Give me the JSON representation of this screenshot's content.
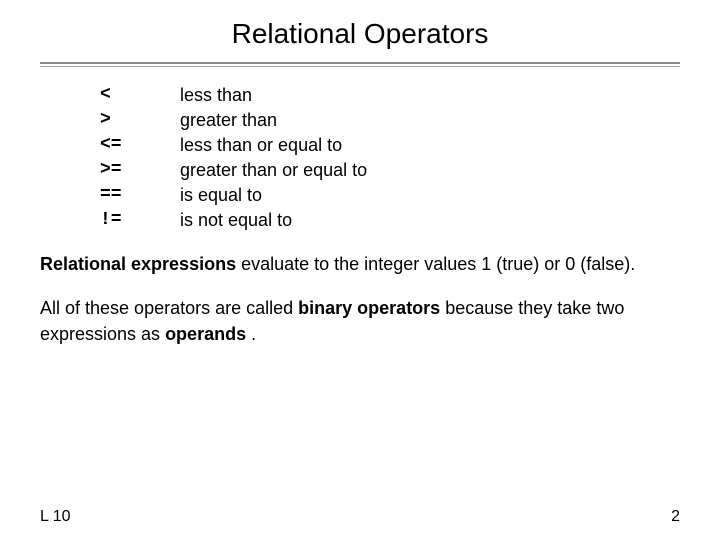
{
  "header": {
    "title": "Relational Operators"
  },
  "operators": [
    {
      "symbol": "<",
      "description": "less than"
    },
    {
      "symbol": ">",
      "description": "greater than"
    },
    {
      "symbol": "<=",
      "description": "less than or equal to"
    },
    {
      "symbol": ">=",
      "description": "greater than or equal to"
    },
    {
      "symbol": "==",
      "description": "is equal to"
    },
    {
      "symbol": "!=",
      "description": "is not equal to"
    }
  ],
  "paragraph1": {
    "bold_part": "Relational expressions",
    "rest": " evaluate to the integer values 1 (true) or 0 (false)."
  },
  "paragraph2": {
    "prefix": "All of these operators are called ",
    "bold_part": "binary operators",
    "middle": " because they take two expressions as ",
    "bold_part2": "operands",
    "suffix": "."
  },
  "footer": {
    "left": "L 10",
    "right": "2"
  }
}
